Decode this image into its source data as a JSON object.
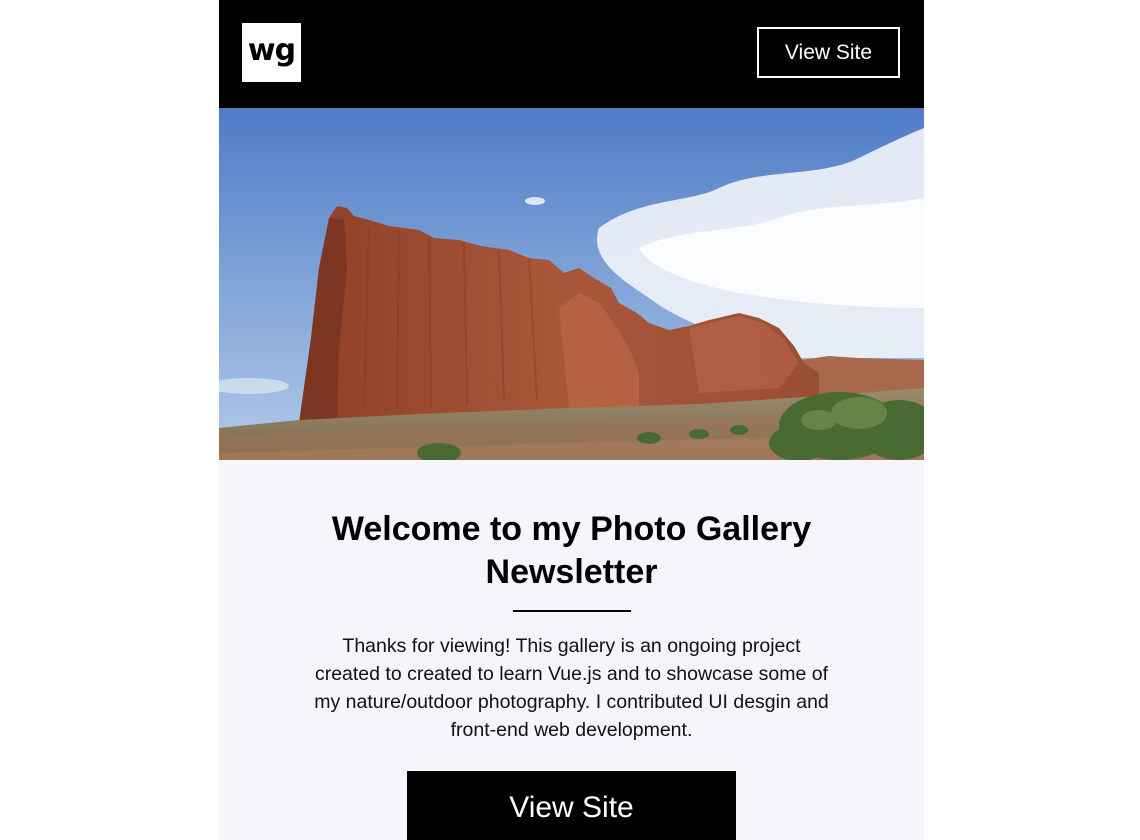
{
  "header": {
    "logo_text": "wg",
    "view_site_label": "View Site"
  },
  "hero": {
    "icon": "landscape-photo",
    "colors": {
      "sky_top": "#5a83c9",
      "sky_bottom": "#a9c3e6",
      "rock": "#a04e34",
      "ground": "#8c7a5e",
      "shrub": "#4c6b35"
    }
  },
  "main": {
    "title": "Welcome to my Photo Gallery Newsletter",
    "body": "Thanks for viewing! This gallery is an ongoing project created to created to learn Vue.js and to showcase some of my nature/outdoor photography. I contributed UI desgin and front-end web development.",
    "cta_label": "View Site"
  },
  "theme": {
    "header_bg": "#000000",
    "content_bg": "#f6f5fb",
    "button_bg": "#000000",
    "button_text": "#ffffff"
  }
}
